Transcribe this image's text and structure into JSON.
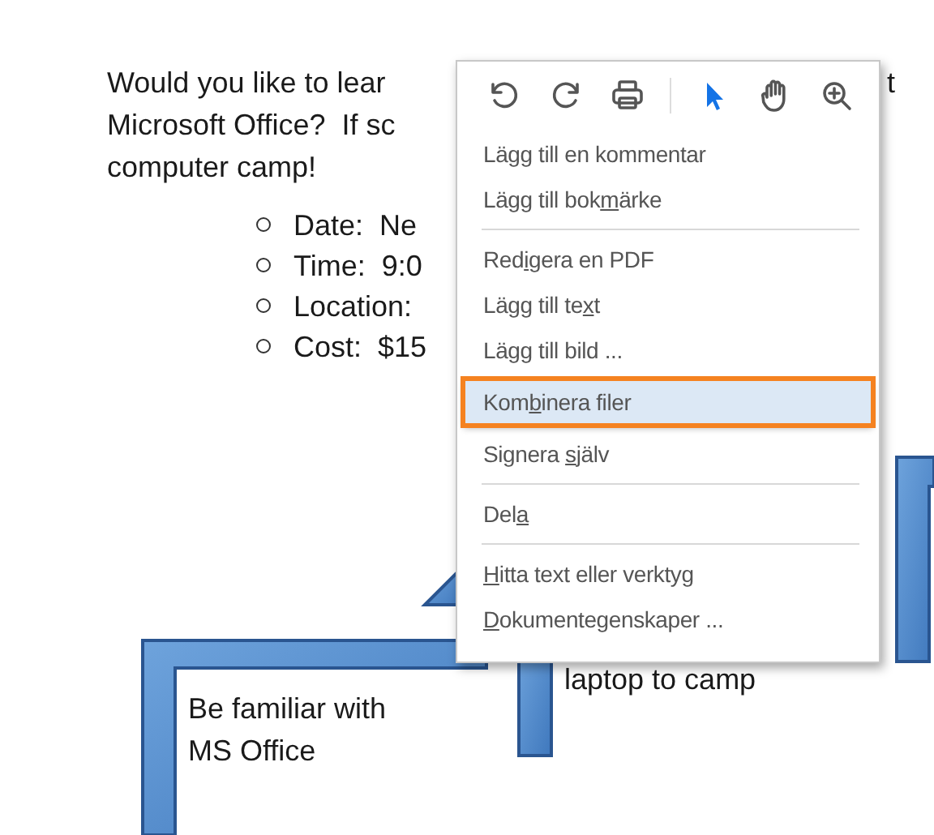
{
  "document": {
    "paragraph_lines": [
      "Would you like to lear",
      "Microsoft Office?  If sc",
      "computer camp!"
    ],
    "line_end_fragment": "t",
    "bullets": [
      "Date:  Ne",
      "Time:  9:0",
      "Location:",
      "Cost:  $15"
    ],
    "text_boxes": [
      {
        "kind": "left",
        "text": "Be familiar with MS Office"
      },
      {
        "kind": "middle",
        "text": "laptop to camp"
      }
    ]
  },
  "context_menu": {
    "toolbar": [
      {
        "kind": "undo",
        "selected": false
      },
      {
        "kind": "redo",
        "selected": false
      },
      {
        "kind": "print",
        "selected": false
      },
      {
        "kind": "separator"
      },
      {
        "kind": "pointer",
        "selected": true
      },
      {
        "kind": "hand",
        "selected": false
      },
      {
        "kind": "zoom-in",
        "selected": false
      }
    ],
    "sections": [
      [
        {
          "before": "Lägg till en kommentar",
          "selected": false
        },
        {
          "before": "Lägg till bok",
          "underlined": "m",
          "after": "ärke",
          "selected": false
        }
      ],
      [
        {
          "before": "Red",
          "underlined": "i",
          "after": "gera en PDF",
          "selected": false
        },
        {
          "before": "Lägg till te",
          "underlined": "x",
          "after": "t",
          "selected": false
        },
        {
          "before": "Lägg till bild ...",
          "selected": false
        },
        {
          "before": "Kom",
          "underlined": "b",
          "after": "inera filer",
          "selected": true
        },
        {
          "before": "Signera ",
          "underlined": "s",
          "after": "jälv",
          "selected": false
        }
      ],
      [
        {
          "before": "Del",
          "underlined": "a",
          "selected": false
        }
      ],
      [
        {
          "underlined": "H",
          "after": "itta text eller verktyg",
          "selected": false
        },
        {
          "underlined": "D",
          "after": "okumentegenskaper ...",
          "selected": false
        }
      ]
    ]
  }
}
